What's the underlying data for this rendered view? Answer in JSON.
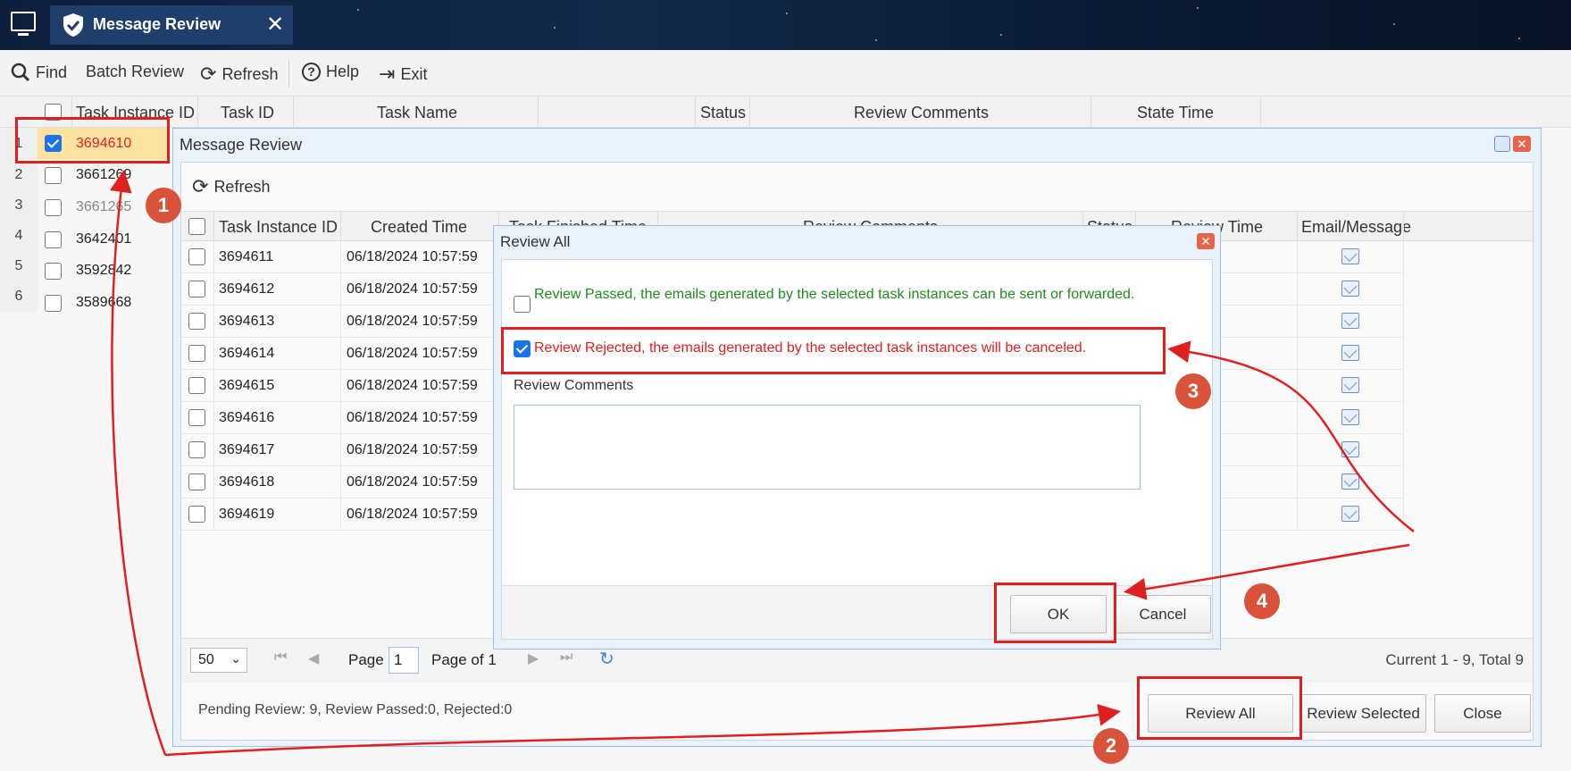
{
  "app": {
    "tab_title": "Message Review"
  },
  "toolbar": {
    "find": "Find",
    "batch_review": "Batch Review",
    "refresh": "Refresh",
    "help": "Help",
    "exit": "Exit"
  },
  "main_grid": {
    "columns": [
      "Task Instance ID",
      "Task ID",
      "Task Name",
      "Status",
      "Review Comments",
      "State Time"
    ],
    "rows": [
      {
        "num": "1",
        "id": "3694610",
        "checked": true
      },
      {
        "num": "2",
        "id": "3661269",
        "checked": false
      },
      {
        "num": "3",
        "id": "3661265",
        "checked": false
      },
      {
        "num": "4",
        "id": "3642401",
        "checked": false
      },
      {
        "num": "5",
        "id": "3592842",
        "checked": false
      },
      {
        "num": "6",
        "id": "3589668",
        "checked": false
      }
    ]
  },
  "review_window": {
    "title": "Message Review",
    "refresh": "Refresh",
    "columns": [
      "Task Instance ID",
      "Created Time",
      "Task Finished Time",
      "Review Comments",
      "Status",
      "Review Time",
      "Email/Message"
    ],
    "rows": [
      {
        "id": "3694611",
        "created": "06/18/2024 10:57:59"
      },
      {
        "id": "3694612",
        "created": "06/18/2024 10:57:59"
      },
      {
        "id": "3694613",
        "created": "06/18/2024 10:57:59"
      },
      {
        "id": "3694614",
        "created": "06/18/2024 10:57:59"
      },
      {
        "id": "3694615",
        "created": "06/18/2024 10:57:59"
      },
      {
        "id": "3694616",
        "created": "06/18/2024 10:57:59"
      },
      {
        "id": "3694617",
        "created": "06/18/2024 10:57:59"
      },
      {
        "id": "3694618",
        "created": "06/18/2024 10:57:59"
      },
      {
        "id": "3694619",
        "created": "06/18/2024 10:57:59"
      }
    ],
    "pager": {
      "page_size": "50",
      "page_label": "Page",
      "page_value": "1",
      "page_of": "Page of 1",
      "summary": "Current 1 - 9, Total 9"
    },
    "status": "Pending Review: 9, Review Passed:0, Rejected:0",
    "buttons": {
      "review_all": "Review All",
      "review_selected": "Review Selected",
      "close": "Close"
    }
  },
  "dialog": {
    "title": "Review All",
    "option_passed": "Review Passed, the emails generated by the selected task instances can be sent or forwarded.",
    "option_rejected": "Review Rejected, the emails generated by the selected task instances will be canceled.",
    "comments_label": "Review Comments",
    "ok": "OK",
    "cancel": "Cancel"
  },
  "annotations": {
    "b1": "1",
    "b2": "2",
    "b3": "3",
    "b4": "4"
  },
  "colors": {
    "accent_red": "#e02020",
    "passed_green": "#1e8a1e",
    "badge": "#d9533a"
  }
}
